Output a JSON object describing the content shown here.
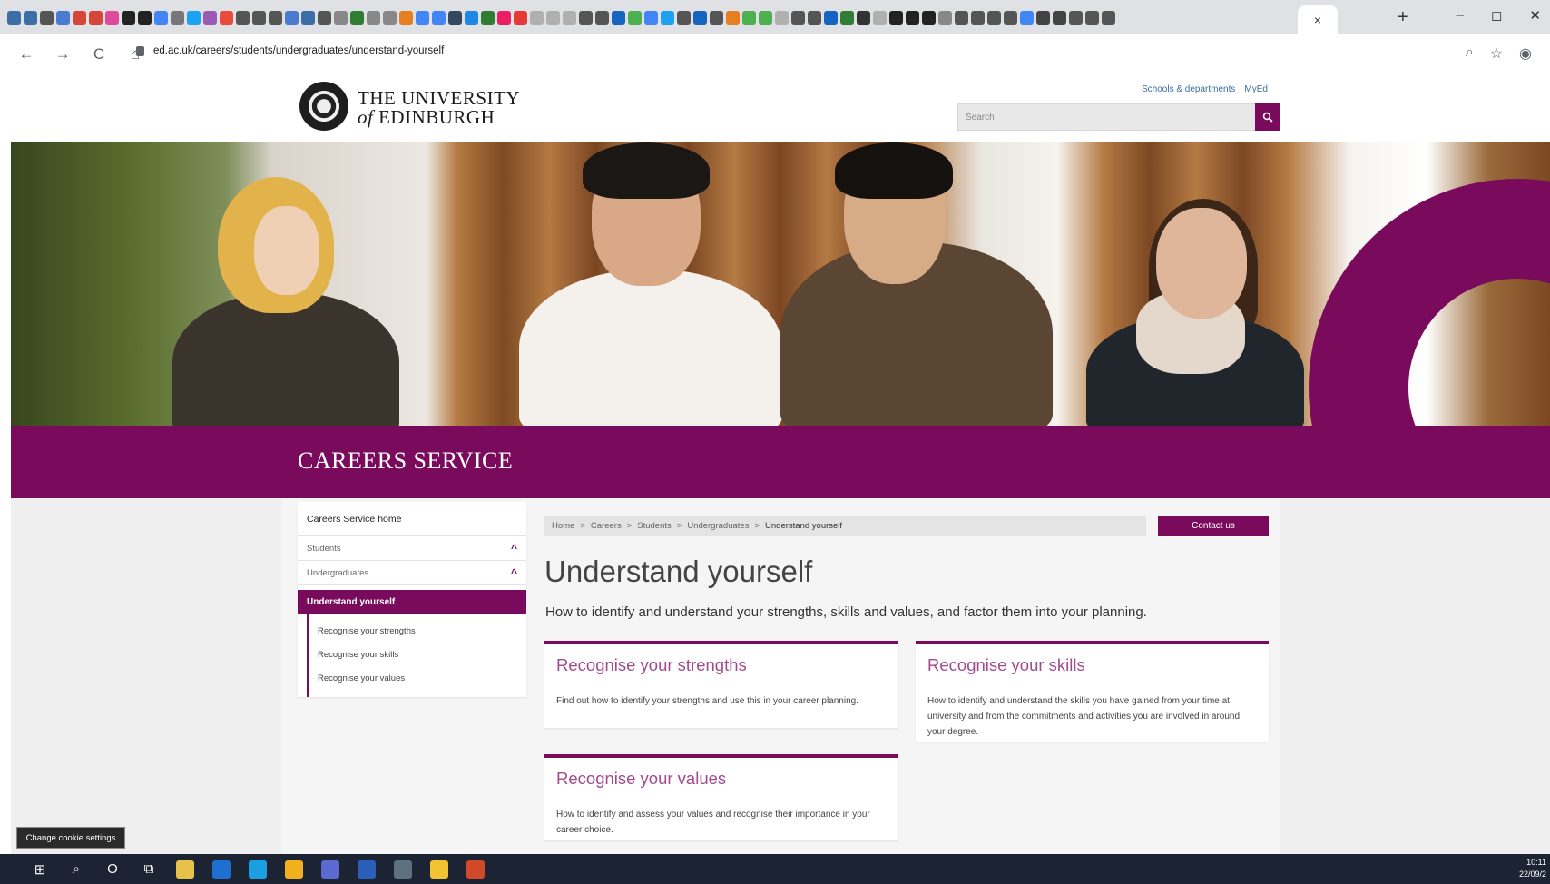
{
  "browser": {
    "favicon_colors": [
      "#3b6ea5",
      "#3b6ea5",
      "#555555",
      "#4a7bd1",
      "#d44638",
      "#d44638",
      "#e04a9a",
      "#222222",
      "#222222",
      "#4285f4",
      "#777777",
      "#1da1f2",
      "#9b59b6",
      "#e74c3c",
      "#555555",
      "#555555",
      "#555555",
      "#4a7bd1",
      "#3b6ea5",
      "#555555",
      "#888888",
      "#2e7d32",
      "#888888",
      "#888888",
      "#e67e22",
      "#4285f4",
      "#4285f4",
      "#34495e",
      "#1e88e5",
      "#2e7d32",
      "#e91e63",
      "#e53935",
      "#b0b0b0",
      "#b0b0b0",
      "#b0b0b0",
      "#555555",
      "#555555",
      "#1565c0",
      "#4caf50",
      "#4285f4",
      "#1da1f2",
      "#555555",
      "#1565c0",
      "#555555",
      "#e67e22",
      "#4caf50",
      "#4caf50",
      "#b0b0b0",
      "#555555",
      "#555555",
      "#1565c0",
      "#2e7d32",
      "#333333",
      "#b0b0b0",
      "#222222",
      "#222222",
      "#222222",
      "#888888",
      "#555555",
      "#555555",
      "#555555",
      "#555555",
      "#4285f4",
      "#444444",
      "#444444",
      "#555555",
      "#555555",
      "#555555"
    ],
    "active_tab_close": "×",
    "new_tab": "+",
    "window_controls": [
      "–",
      "◻",
      "✕"
    ],
    "nav": {
      "back": "←",
      "forward": "→",
      "reload": "C",
      "home": "⌂"
    },
    "url": "ed.ac.uk/careers/students/undergraduates/understand-yourself",
    "toolbar_icons": [
      "zoom-icon",
      "star-icon",
      "profile-icon"
    ]
  },
  "header": {
    "logo_line1": "THE UNIVERSITY",
    "logo_line2_of": "of",
    "logo_line2": "EDINBURGH",
    "links": [
      "Schools & departments",
      "MyEd"
    ],
    "search_placeholder": "Search"
  },
  "band": {
    "title": "CAREERS SERVICE"
  },
  "sidenav": {
    "home": "Careers Service home",
    "rows": [
      {
        "label": "Students",
        "chevron": "^"
      },
      {
        "label": "Undergraduates",
        "chevron": "^"
      }
    ],
    "active": "Understand yourself",
    "subs": [
      "Recognise your strengths",
      "Recognise your skills",
      "Recognise your values"
    ]
  },
  "breadcrumb": {
    "items": [
      "Home",
      "Careers",
      "Students",
      "Undergraduates"
    ],
    "separator": ">",
    "current": "Understand yourself"
  },
  "contact_button": "Contact us",
  "main": {
    "title": "Understand yourself",
    "intro": "How to identify and understand your strengths, skills and values, and factor them into your planning.",
    "cards": [
      {
        "title": "Recognise your strengths",
        "text": "Find out how to identify your strengths and use this in your career planning."
      },
      {
        "title": "Recognise your skills",
        "text": "How to identify and understand the skills you have gained from your time at university and from the commitments and activities you are involved in around your degree."
      },
      {
        "title": "Recognise your values",
        "text": "How to identify and assess your values and recognise their importance in your career choice."
      }
    ]
  },
  "cookie_button": "Change cookie settings",
  "taskbar": {
    "start": "⊞",
    "search": "⌕",
    "cortana": "O",
    "task_view": "⧉",
    "apps": [
      "#e8c14a",
      "#1e6fd0",
      "#1aa0e0",
      "#f2b01e",
      "#5b6ad0",
      "#2b5eb8",
      "#5c7080",
      "#f1c232",
      "#d04a2a"
    ],
    "time": "10:11",
    "date": "22/09/2"
  },
  "colors": {
    "brand": "#7a0a5c",
    "card_title": "#a24a8e"
  }
}
